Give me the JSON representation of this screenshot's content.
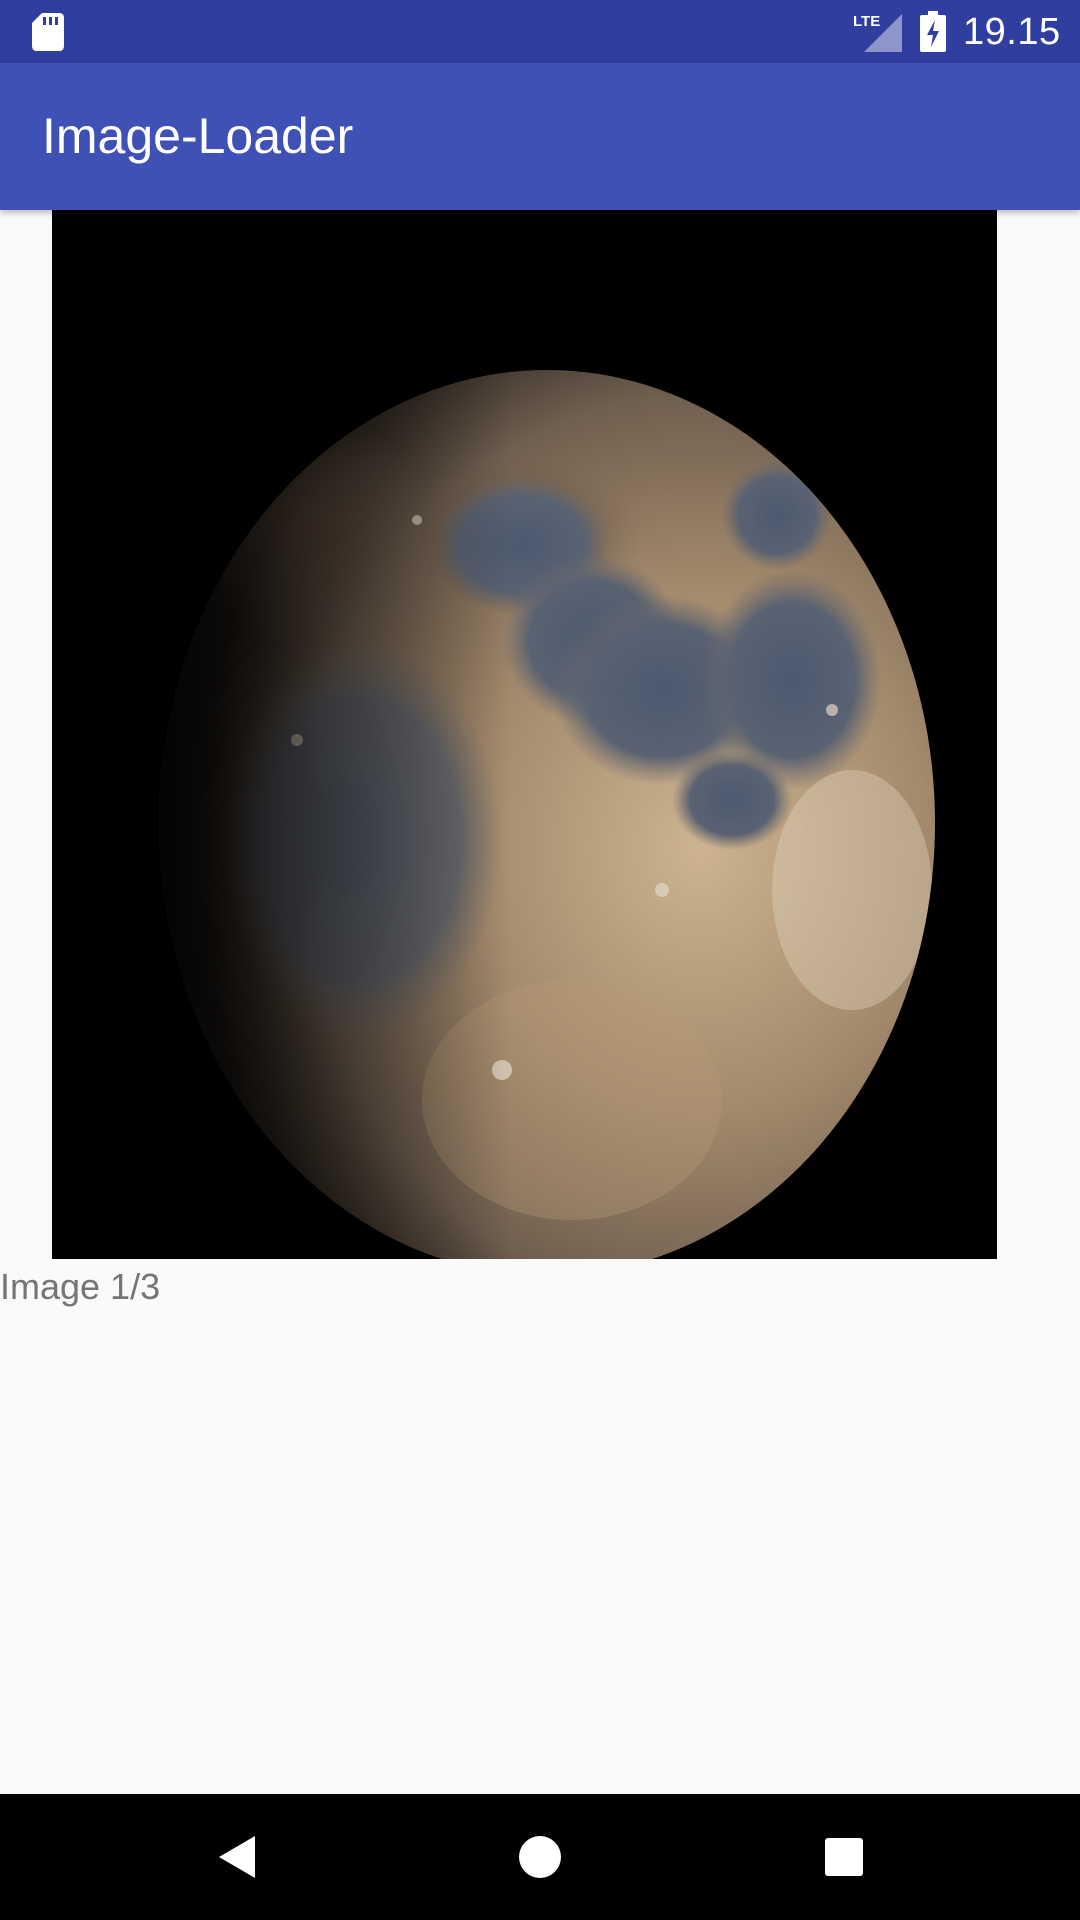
{
  "status_bar": {
    "time": "19.15",
    "network_label": "LTE",
    "icons": [
      "sd-card-icon",
      "lte-signal-icon",
      "battery-charging-icon"
    ]
  },
  "app_bar": {
    "title": "Image-Loader"
  },
  "viewer": {
    "image_subject": "moon",
    "counter_text": "Image 1/3"
  },
  "nav_bar": {
    "icons": [
      "back-icon",
      "home-icon",
      "recents-icon"
    ]
  },
  "colors": {
    "status_bar": "#303f9f",
    "app_bar": "#3f51b5",
    "background": "#fafafa",
    "counter_text": "#757575",
    "nav_bar": "#000000"
  }
}
